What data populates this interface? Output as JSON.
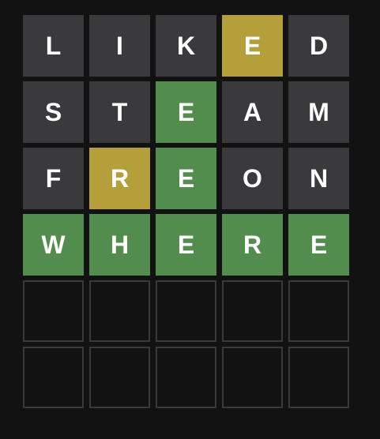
{
  "colors": {
    "background": "#121213",
    "absent": "#3a3a3c",
    "present": "#b59f3b",
    "correct": "#538d4e",
    "empty_border": "#3a3a3c",
    "letter": "#ffffff"
  },
  "board": {
    "rows": [
      {
        "word": "LIKED",
        "tiles": [
          {
            "letter": "L",
            "state": "absent"
          },
          {
            "letter": "I",
            "state": "absent"
          },
          {
            "letter": "K",
            "state": "absent"
          },
          {
            "letter": "E",
            "state": "present"
          },
          {
            "letter": "D",
            "state": "absent"
          }
        ]
      },
      {
        "word": "STEAM",
        "tiles": [
          {
            "letter": "S",
            "state": "absent"
          },
          {
            "letter": "T",
            "state": "absent"
          },
          {
            "letter": "E",
            "state": "correct"
          },
          {
            "letter": "A",
            "state": "absent"
          },
          {
            "letter": "M",
            "state": "absent"
          }
        ]
      },
      {
        "word": "FREON",
        "tiles": [
          {
            "letter": "F",
            "state": "absent"
          },
          {
            "letter": "R",
            "state": "present"
          },
          {
            "letter": "E",
            "state": "correct"
          },
          {
            "letter": "O",
            "state": "absent"
          },
          {
            "letter": "N",
            "state": "absent"
          }
        ]
      },
      {
        "word": "WHERE",
        "tiles": [
          {
            "letter": "W",
            "state": "correct"
          },
          {
            "letter": "H",
            "state": "correct"
          },
          {
            "letter": "E",
            "state": "correct"
          },
          {
            "letter": "R",
            "state": "correct"
          },
          {
            "letter": "E",
            "state": "correct"
          }
        ]
      },
      {
        "word": "",
        "tiles": [
          {
            "letter": "",
            "state": "empty"
          },
          {
            "letter": "",
            "state": "empty"
          },
          {
            "letter": "",
            "state": "empty"
          },
          {
            "letter": "",
            "state": "empty"
          },
          {
            "letter": "",
            "state": "empty"
          }
        ]
      },
      {
        "word": "",
        "tiles": [
          {
            "letter": "",
            "state": "empty"
          },
          {
            "letter": "",
            "state": "empty"
          },
          {
            "letter": "",
            "state": "empty"
          },
          {
            "letter": "",
            "state": "empty"
          },
          {
            "letter": "",
            "state": "empty"
          }
        ]
      }
    ]
  }
}
